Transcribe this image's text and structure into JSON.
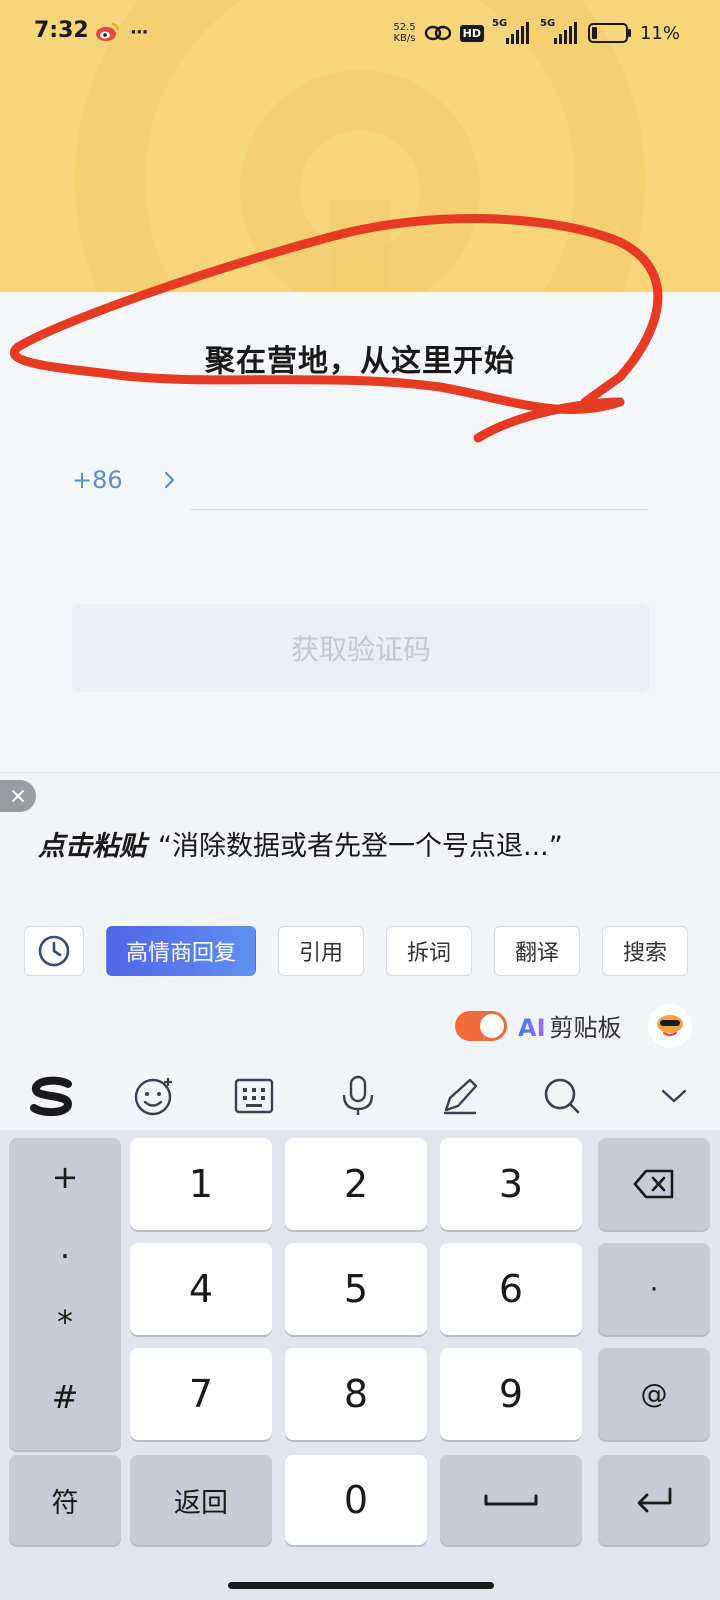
{
  "status_bar": {
    "time": "7:32",
    "more_indicator": "···",
    "net_speed_value": "52.5",
    "net_speed_unit": "KB/s",
    "hd_badge": "HD",
    "signal1_label": "5G",
    "signal2_label": "5G",
    "battery_percent": "11%",
    "icons": [
      "weibo-icon",
      "link-icon",
      "signal-icon",
      "battery-icon"
    ]
  },
  "welcome": {
    "title": "聚在营地，从这里开始"
  },
  "phone_form": {
    "country_code": "+86",
    "phone_value": "",
    "phone_placeholder": "",
    "get_code_label": "获取验证码"
  },
  "clipboard": {
    "paste_label": "点击粘贴",
    "paste_preview": "“消除数据或者先登一个号点退...”"
  },
  "ime_toolbar": {
    "chips": [
      "高情商回复",
      "引用",
      "拆词",
      "翻译",
      "搜索"
    ]
  },
  "ai_clipboard": {
    "ai_text": "AI",
    "label": "剪贴板",
    "toggle_on": true
  },
  "keyboard": {
    "symbols": [
      "+",
      ".",
      "*",
      "#"
    ],
    "digits": [
      "1",
      "2",
      "3",
      "4",
      "5",
      "6",
      "7",
      "8",
      "9",
      "0"
    ],
    "right_keys": {
      "dot": "·",
      "at": "@"
    },
    "bottom_keys": {
      "fu": "符",
      "back": "返回"
    }
  },
  "colors": {
    "header_yellow": "#f7d57c",
    "annotation_red": "#e63b22",
    "primary_blue": "#4f67e8",
    "toggle_orange": "#f06a3a",
    "country_code_blue": "#5a8fcf"
  }
}
